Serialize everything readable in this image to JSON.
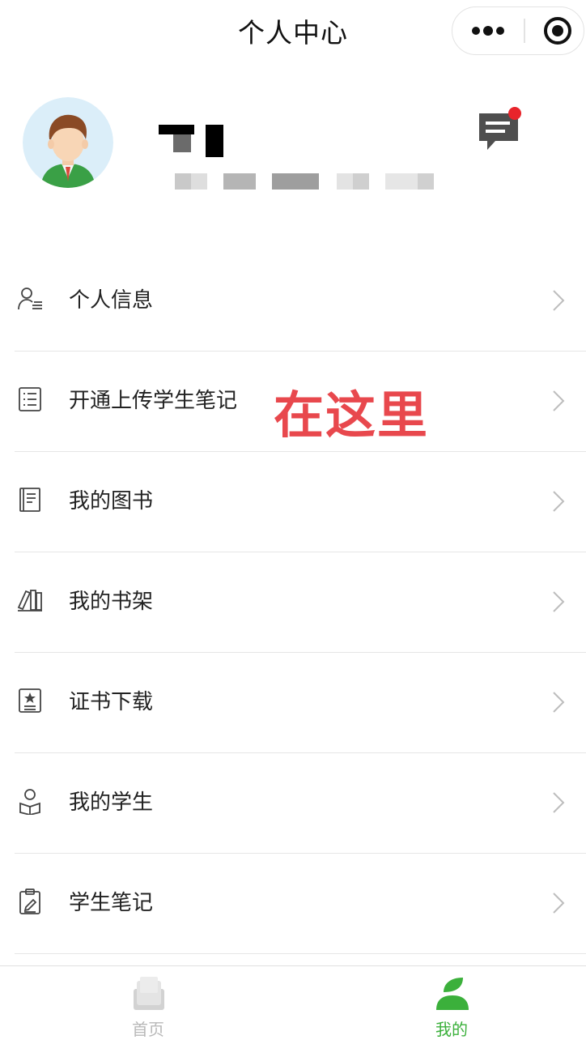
{
  "navbar": {
    "title": "个人中心",
    "more_icon": "more-dots-icon",
    "close_icon": "target-circle-icon"
  },
  "profile": {
    "avatar_icon": "avatar-boy-icon",
    "message_icon": "message-icon",
    "message_badge_color": "#e8242b"
  },
  "menu": {
    "items": [
      {
        "label": "个人信息",
        "icon": "user-profile-icon"
      },
      {
        "label": "开通上传学生笔记",
        "icon": "list-icon"
      },
      {
        "label": "我的图书",
        "icon": "book-icon"
      },
      {
        "label": "我的书架",
        "icon": "bookshelf-icon"
      },
      {
        "label": "证书下载",
        "icon": "certificate-icon"
      },
      {
        "label": "我的学生",
        "icon": "student-icon"
      },
      {
        "label": "学生笔记",
        "icon": "clipboard-icon"
      }
    ],
    "chevron_icon": "chevron-right-icon"
  },
  "annotation": {
    "text": "在这里",
    "color": "#e8484d"
  },
  "tabbar": {
    "tabs": [
      {
        "label": "首页",
        "icon": "home-book-icon",
        "active": false
      },
      {
        "label": "我的",
        "icon": "mine-person-icon",
        "active": true
      }
    ],
    "active_color": "#3bb03b",
    "inactive_color": "#b8b8b8"
  }
}
